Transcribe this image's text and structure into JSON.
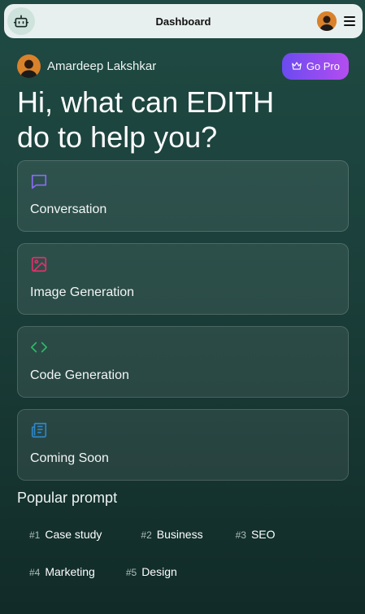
{
  "header": {
    "title": "Dashboard",
    "logo_icon": "robot-icon",
    "menu_icon": "hamburger-menu-icon"
  },
  "user": {
    "name": "Amardeep Lakshkar"
  },
  "go_pro": {
    "label": "Go Pro",
    "icon": "crown-icon"
  },
  "greeting": {
    "line1": "Hi, what can EDITH",
    "line2": "do to help you?"
  },
  "cards": [
    {
      "label": "Conversation",
      "icon": "chat-bubble-icon",
      "color": "#8b6cf6"
    },
    {
      "label": "Image Generation",
      "icon": "image-icon",
      "color": "#e0306a"
    },
    {
      "label": "Code Generation",
      "icon": "code-icon",
      "color": "#2fb86a"
    },
    {
      "label": "Coming Soon",
      "icon": "newspaper-icon",
      "color": "#2f86c8"
    }
  ],
  "popular": {
    "title": "Popular prompt",
    "items": [
      {
        "num": "#1",
        "label": "Case study"
      },
      {
        "num": "#2",
        "label": "Business"
      },
      {
        "num": "#3",
        "label": "SEO"
      },
      {
        "num": "#4",
        "label": "Marketing"
      },
      {
        "num": "#5",
        "label": "Design"
      }
    ]
  }
}
